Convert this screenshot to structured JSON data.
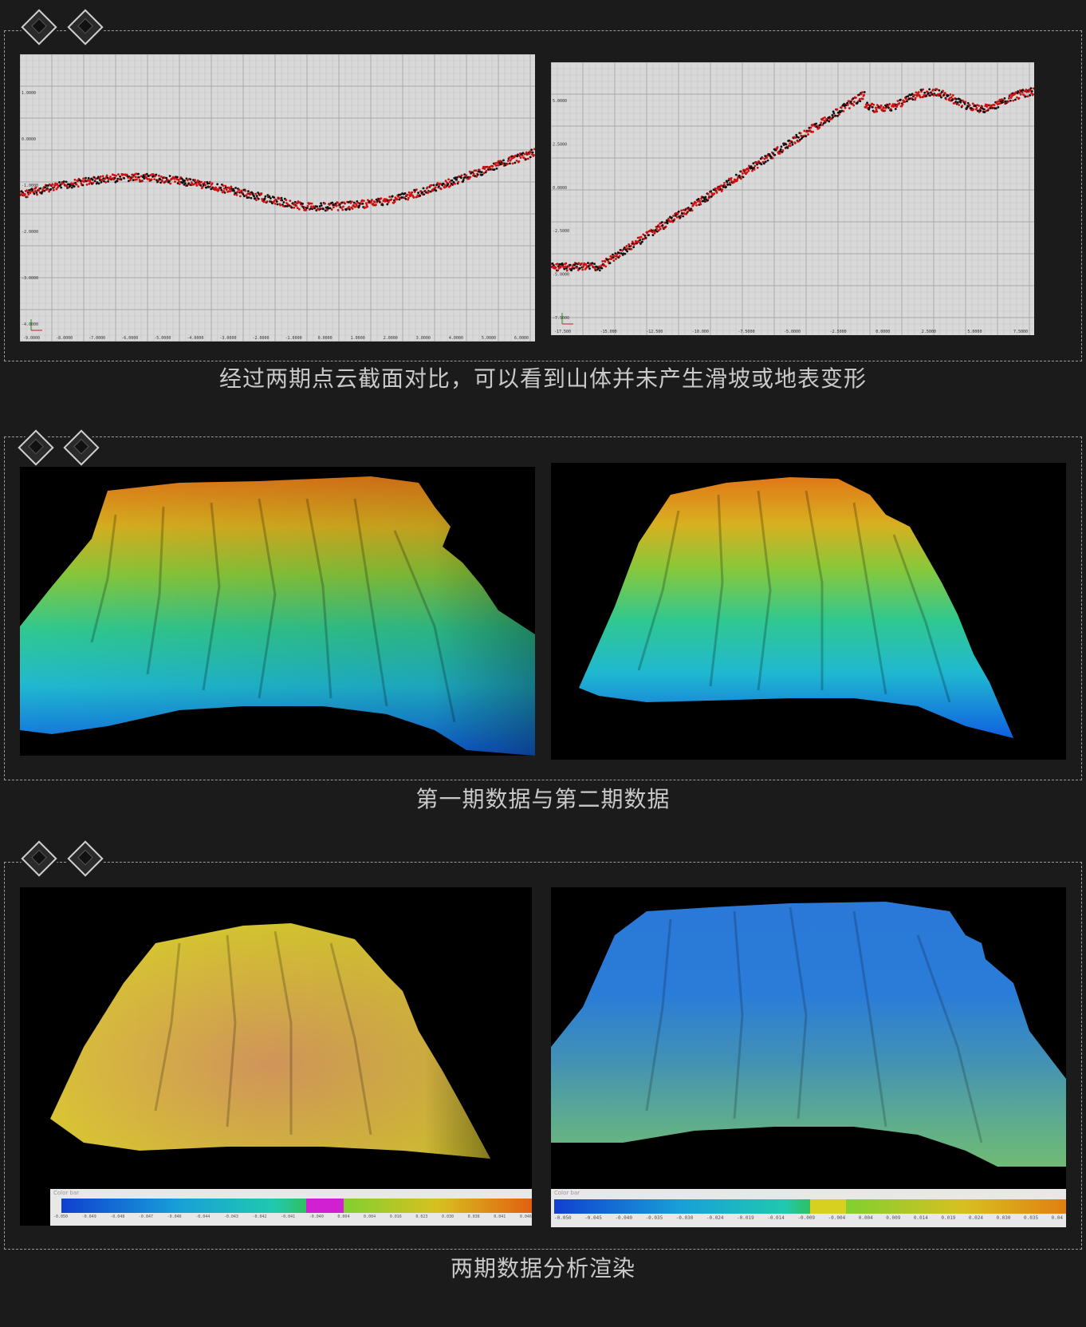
{
  "section1": {
    "caption": "经过两期点云截面对比，可以看到山体并未产生滑坡或地表变形",
    "left_chart": {
      "y_ticks": [
        "1.0000",
        "0.0000",
        "-1.0000",
        "-2.0000",
        "-3.0000",
        "-4.0000"
      ],
      "x_ticks": [
        "-9.0000",
        "-8.0000",
        "-7.0000",
        "-6.0000",
        "-5.0000",
        "-4.0000",
        "-3.0000",
        "-2.0000",
        "-1.0000",
        "0.0000",
        "1.0000",
        "2.0000",
        "3.0000",
        "4.0000",
        "5.0000",
        "6.0000"
      ]
    },
    "right_chart": {
      "y_ticks": [
        "5.0000",
        "2.5000",
        "0.0000",
        "-2.5000",
        "-5.0000",
        "-7.5000"
      ],
      "x_ticks": [
        "-17.500",
        "-15.000",
        "-12.500",
        "-10.000",
        "-7.5000",
        "-5.0000",
        "-2.5000",
        "0.0000",
        "2.5000",
        "5.0000",
        "7.5000"
      ]
    }
  },
  "section2": {
    "caption": "第一期数据与第二期数据"
  },
  "section3": {
    "caption": "两期数据分析渲染",
    "left_colorbar": {
      "title": "Color bar",
      "ticks": [
        "-0.050",
        "-0.049",
        "-0.048",
        "-0.047",
        "-0.046",
        "-0.044",
        "-0.043",
        "-0.042",
        "-0.041",
        "-0.040",
        "0.004",
        "0.004",
        "0.016",
        "0.023",
        "0.030",
        "0.036",
        "0.041",
        "0.046"
      ]
    },
    "right_colorbar": {
      "title": "Color bar",
      "ticks": [
        "-0.050",
        "-0.045",
        "-0.040",
        "-0.035",
        "-0.030",
        "-0.024",
        "-0.019",
        "-0.014",
        "-0.009",
        "-0.004",
        "0.004",
        "0.009",
        "0.014",
        "0.019",
        "0.024",
        "0.030",
        "0.035",
        "0.04"
      ]
    }
  }
}
